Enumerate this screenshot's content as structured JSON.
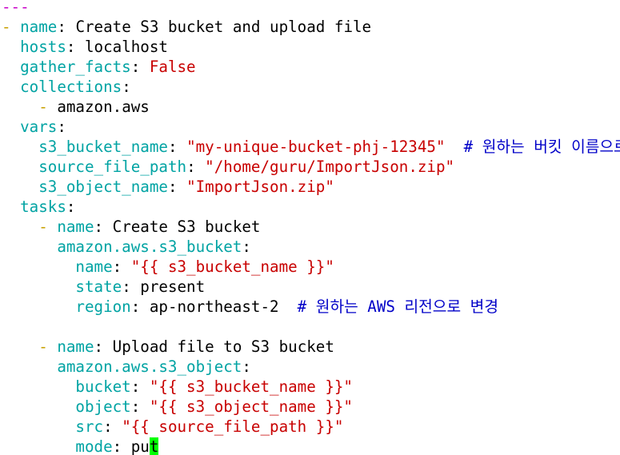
{
  "editor": {
    "lines": [
      {
        "parts": [
          {
            "t": "doc",
            "v": "---"
          }
        ]
      },
      {
        "parts": [
          {
            "t": "d",
            "v": "- "
          },
          {
            "t": "k",
            "v": "name"
          },
          {
            "t": "sep",
            "v": ": "
          },
          {
            "t": "p",
            "v": "Create S3 bucket and upload file"
          }
        ]
      },
      {
        "parts": [
          {
            "t": "p",
            "v": "  "
          },
          {
            "t": "k",
            "v": "hosts"
          },
          {
            "t": "sep",
            "v": ": "
          },
          {
            "t": "p",
            "v": "localhost"
          }
        ]
      },
      {
        "parts": [
          {
            "t": "p",
            "v": "  "
          },
          {
            "t": "k",
            "v": "gather_facts"
          },
          {
            "t": "sep",
            "v": ": "
          },
          {
            "t": "f",
            "v": "False"
          }
        ]
      },
      {
        "parts": [
          {
            "t": "p",
            "v": "  "
          },
          {
            "t": "k",
            "v": "collections"
          },
          {
            "t": "sep",
            "v": ":"
          }
        ]
      },
      {
        "parts": [
          {
            "t": "p",
            "v": "    "
          },
          {
            "t": "d",
            "v": "- "
          },
          {
            "t": "p",
            "v": "amazon.aws"
          }
        ]
      },
      {
        "parts": [
          {
            "t": "p",
            "v": "  "
          },
          {
            "t": "k",
            "v": "vars"
          },
          {
            "t": "sep",
            "v": ":"
          }
        ]
      },
      {
        "parts": [
          {
            "t": "p",
            "v": "    "
          },
          {
            "t": "k",
            "v": "s3_bucket_name"
          },
          {
            "t": "sep",
            "v": ": "
          },
          {
            "t": "s",
            "v": "\"my-unique-bucket-phj-12345\""
          },
          {
            "t": "c",
            "v": "  # 원하는 버킷 이름으로 변경"
          }
        ]
      },
      {
        "parts": [
          {
            "t": "p",
            "v": "    "
          },
          {
            "t": "k",
            "v": "source_file_path"
          },
          {
            "t": "sep",
            "v": ": "
          },
          {
            "t": "s",
            "v": "\"/home/guru/ImportJson.zip\""
          }
        ]
      },
      {
        "parts": [
          {
            "t": "p",
            "v": "    "
          },
          {
            "t": "k",
            "v": "s3_object_name"
          },
          {
            "t": "sep",
            "v": ": "
          },
          {
            "t": "s",
            "v": "\"ImportJson.zip\""
          }
        ]
      },
      {
        "parts": [
          {
            "t": "p",
            "v": "  "
          },
          {
            "t": "k",
            "v": "tasks"
          },
          {
            "t": "sep",
            "v": ":"
          }
        ]
      },
      {
        "parts": [
          {
            "t": "p",
            "v": "    "
          },
          {
            "t": "d",
            "v": "- "
          },
          {
            "t": "k",
            "v": "name"
          },
          {
            "t": "sep",
            "v": ": "
          },
          {
            "t": "p",
            "v": "Create S3 bucket"
          }
        ]
      },
      {
        "parts": [
          {
            "t": "p",
            "v": "      "
          },
          {
            "t": "k",
            "v": "amazon.aws.s3_bucket"
          },
          {
            "t": "sep",
            "v": ":"
          }
        ]
      },
      {
        "parts": [
          {
            "t": "p",
            "v": "        "
          },
          {
            "t": "k",
            "v": "name"
          },
          {
            "t": "sep",
            "v": ": "
          },
          {
            "t": "s",
            "v": "\"{{ s3_bucket_name }}\""
          }
        ]
      },
      {
        "parts": [
          {
            "t": "p",
            "v": "        "
          },
          {
            "t": "k",
            "v": "state"
          },
          {
            "t": "sep",
            "v": ": "
          },
          {
            "t": "p",
            "v": "present"
          }
        ]
      },
      {
        "parts": [
          {
            "t": "p",
            "v": "        "
          },
          {
            "t": "k",
            "v": "region"
          },
          {
            "t": "sep",
            "v": ": "
          },
          {
            "t": "p",
            "v": "ap-northeast-2"
          },
          {
            "t": "c",
            "v": "  # 원하는 AWS 리전으로 변경"
          }
        ]
      },
      {
        "parts": [
          {
            "t": "p",
            "v": ""
          }
        ]
      },
      {
        "parts": [
          {
            "t": "p",
            "v": "    "
          },
          {
            "t": "d",
            "v": "- "
          },
          {
            "t": "k",
            "v": "name"
          },
          {
            "t": "sep",
            "v": ": "
          },
          {
            "t": "p",
            "v": "Upload file to S3 bucket"
          }
        ]
      },
      {
        "parts": [
          {
            "t": "p",
            "v": "      "
          },
          {
            "t": "k",
            "v": "amazon.aws.s3_object"
          },
          {
            "t": "sep",
            "v": ":"
          }
        ]
      },
      {
        "parts": [
          {
            "t": "p",
            "v": "        "
          },
          {
            "t": "k",
            "v": "bucket"
          },
          {
            "t": "sep",
            "v": ": "
          },
          {
            "t": "s",
            "v": "\"{{ s3_bucket_name }}\""
          }
        ]
      },
      {
        "parts": [
          {
            "t": "p",
            "v": "        "
          },
          {
            "t": "k",
            "v": "object"
          },
          {
            "t": "sep",
            "v": ": "
          },
          {
            "t": "s",
            "v": "\"{{ s3_object_name }}\""
          }
        ]
      },
      {
        "parts": [
          {
            "t": "p",
            "v": "        "
          },
          {
            "t": "k",
            "v": "src"
          },
          {
            "t": "sep",
            "v": ": "
          },
          {
            "t": "s",
            "v": "\"{{ source_file_path }}\""
          }
        ]
      },
      {
        "parts": [
          {
            "t": "p",
            "v": "        "
          },
          {
            "t": "k",
            "v": "mode"
          },
          {
            "t": "sep",
            "v": ": "
          },
          {
            "t": "p",
            "v": "pu"
          },
          {
            "t": "cursor",
            "v": "t"
          }
        ]
      }
    ]
  },
  "colors": {
    "key": "#00a3a3",
    "string": "#c80000",
    "comment": "#0000c8",
    "cursor": "#00ff00"
  }
}
